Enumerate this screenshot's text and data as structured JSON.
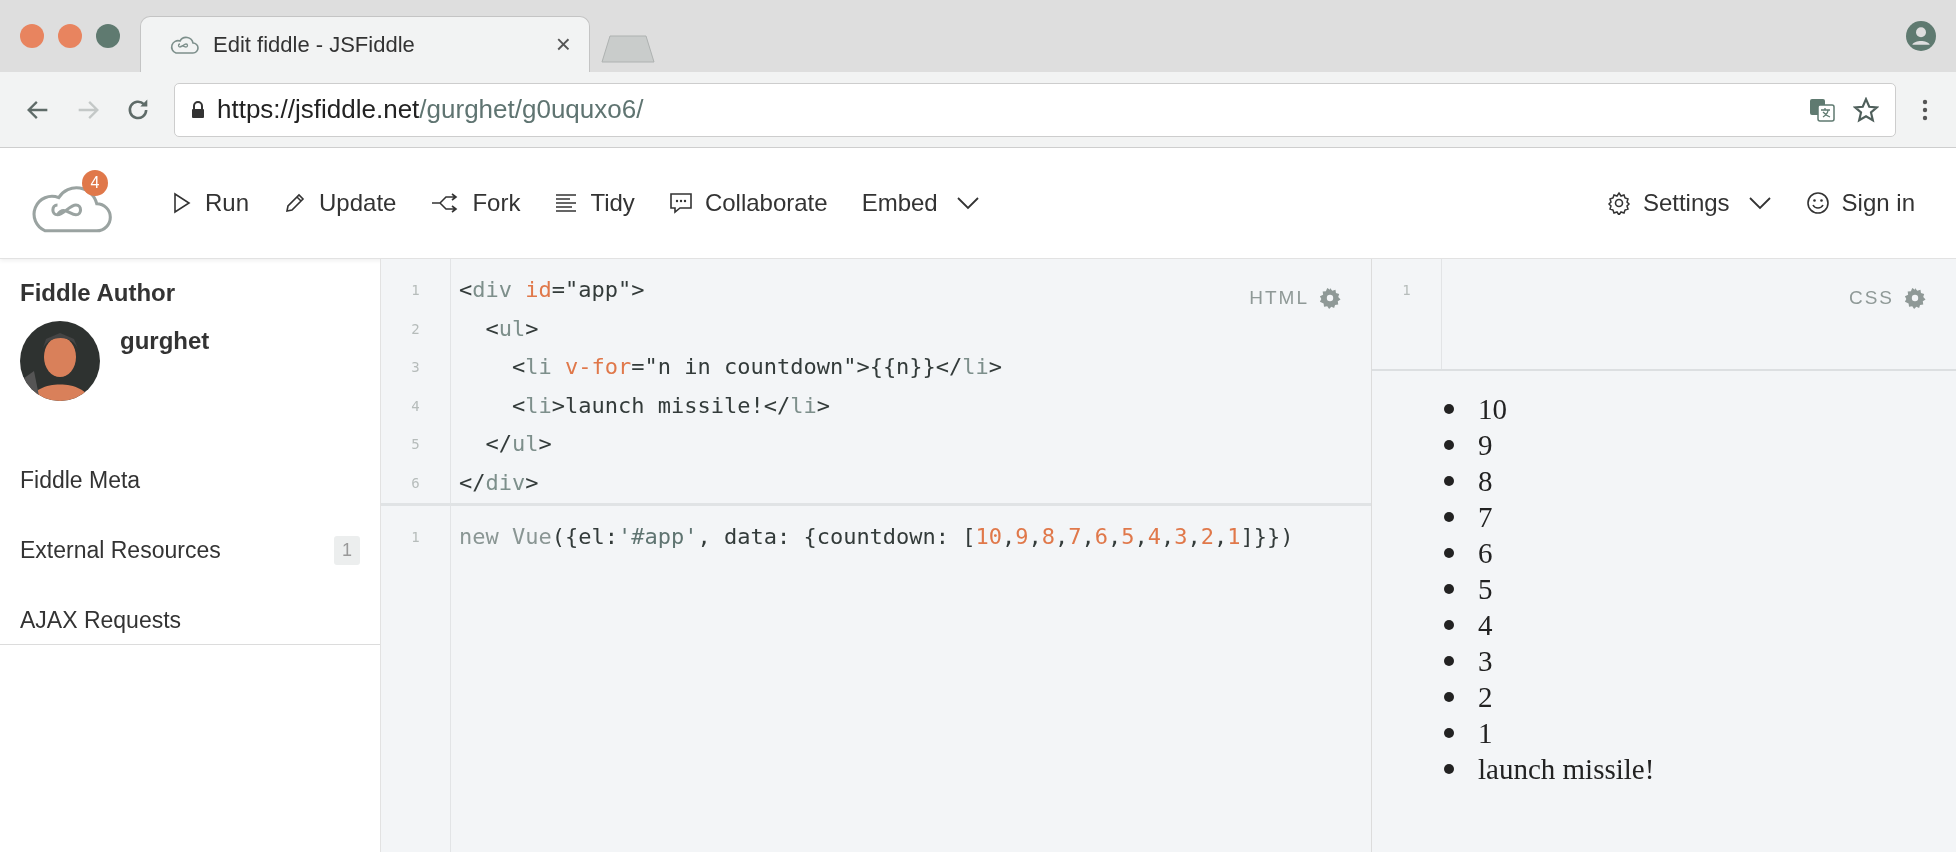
{
  "browser": {
    "tab": {
      "title": "Edit fiddle - JSFiddle",
      "close": "×"
    },
    "nav": [
      {
        "kind": "back",
        "disabled": false
      },
      {
        "kind": "forward",
        "disabled": true
      },
      {
        "kind": "reload",
        "disabled": false
      }
    ],
    "url": {
      "host": "https://jsfiddle.net",
      "path": "/gurghet/g0uquxo6/"
    }
  },
  "toolbar": {
    "badge": "4",
    "left": [
      {
        "label": "Run",
        "dropdown": false
      },
      {
        "label": "Update",
        "dropdown": false
      },
      {
        "label": "Fork",
        "dropdown": false
      },
      {
        "label": "Tidy",
        "dropdown": false
      },
      {
        "label": "Collaborate",
        "dropdown": false
      },
      {
        "label": "Embed",
        "dropdown": true
      }
    ],
    "right": [
      {
        "label": "Settings",
        "dropdown": true
      },
      {
        "label": "Sign in",
        "dropdown": false
      }
    ]
  },
  "sidebar": {
    "heading": "Fiddle Author",
    "author": "gurghet",
    "items": [
      {
        "label": "Fiddle Meta"
      },
      {
        "label": "External Resources",
        "count": "1"
      },
      {
        "label": "AJAX Requests"
      }
    ]
  },
  "html_panel": {
    "label": "HTML",
    "lines": [
      {
        "number": "1",
        "tokens": [
          {
            "text": "<",
            "kind": "punct"
          },
          {
            "text": "div",
            "kind": "tag"
          },
          {
            "text": " id",
            "kind": "attr"
          },
          {
            "text": "=\"app\">",
            "kind": "punct"
          }
        ]
      },
      {
        "number": "2",
        "tokens": [
          {
            "text": "  <",
            "kind": "punct"
          },
          {
            "text": "ul",
            "kind": "tag"
          },
          {
            "text": ">",
            "kind": "punct"
          }
        ]
      },
      {
        "number": "3",
        "tokens": [
          {
            "text": "    <",
            "kind": "punct"
          },
          {
            "text": "li",
            "kind": "tag"
          },
          {
            "text": " v-for",
            "kind": "attr"
          },
          {
            "text": "=\"n in countdown\">{{n}}</",
            "kind": "punct"
          },
          {
            "text": "li",
            "kind": "tag"
          },
          {
            "text": ">",
            "kind": "punct"
          }
        ]
      },
      {
        "number": "4",
        "tokens": [
          {
            "text": "    <",
            "kind": "punct"
          },
          {
            "text": "li",
            "kind": "tag"
          },
          {
            "text": ">launch missile!</",
            "kind": "punct"
          },
          {
            "text": "li",
            "kind": "tag"
          },
          {
            "text": ">",
            "kind": "punct"
          }
        ]
      },
      {
        "number": "5",
        "tokens": [
          {
            "text": "  </",
            "kind": "punct"
          },
          {
            "text": "ul",
            "kind": "tag"
          },
          {
            "text": ">",
            "kind": "punct"
          }
        ]
      },
      {
        "number": "6",
        "tokens": [
          {
            "text": "</",
            "kind": "punct"
          },
          {
            "text": "div",
            "kind": "tag"
          },
          {
            "text": ">",
            "kind": "punct"
          }
        ]
      }
    ]
  },
  "js_panel": {
    "lines": [
      {
        "number": "1",
        "tokens": [
          {
            "text": "new Vue",
            "kind": "keyword"
          },
          {
            "text": "({el:",
            "kind": "punct"
          },
          {
            "text": "'#app'",
            "kind": "string"
          },
          {
            "text": ", data: {countdown: [",
            "kind": "punct"
          },
          {
            "text": "10",
            "kind": "number"
          },
          {
            "text": ",",
            "kind": "punct"
          },
          {
            "text": "9",
            "kind": "number"
          },
          {
            "text": ",",
            "kind": "punct"
          },
          {
            "text": "8",
            "kind": "number"
          },
          {
            "text": ",",
            "kind": "punct"
          },
          {
            "text": "7",
            "kind": "number"
          },
          {
            "text": ",",
            "kind": "punct"
          },
          {
            "text": "6",
            "kind": "number"
          },
          {
            "text": ",",
            "kind": "punct"
          },
          {
            "text": "5",
            "kind": "number"
          },
          {
            "text": ",",
            "kind": "punct"
          },
          {
            "text": "4",
            "kind": "number"
          },
          {
            "text": ",",
            "kind": "punct"
          },
          {
            "text": "3",
            "kind": "number"
          },
          {
            "text": ",",
            "kind": "punct"
          },
          {
            "text": "2",
            "kind": "number"
          },
          {
            "text": ",",
            "kind": "punct"
          },
          {
            "text": "1",
            "kind": "number"
          },
          {
            "text": "]}})",
            "kind": "punct"
          }
        ]
      }
    ]
  },
  "css_panel": {
    "label": "CSS",
    "lines": [
      {
        "number": "1"
      }
    ]
  },
  "result": {
    "items": [
      "10",
      "9",
      "8",
      "7",
      "6",
      "5",
      "4",
      "3",
      "2",
      "1",
      "launch missile!"
    ]
  }
}
